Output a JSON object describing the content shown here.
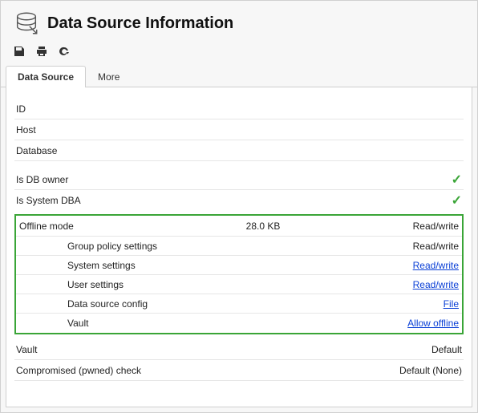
{
  "header": {
    "title": "Data Source Information"
  },
  "toolbar": {
    "save_icon": "save-icon",
    "print_icon": "print-icon",
    "refresh_icon": "refresh-icon"
  },
  "tabs": [
    {
      "label": "Data Source",
      "active": true
    },
    {
      "label": "More",
      "active": false
    }
  ],
  "fields": {
    "id": {
      "label": "ID",
      "value": ""
    },
    "host": {
      "label": "Host",
      "value": ""
    },
    "database": {
      "label": "Database",
      "value": ""
    },
    "is_db_owner": {
      "label": "Is DB owner",
      "checked": true
    },
    "is_system_dba": {
      "label": "Is System DBA",
      "checked": true
    }
  },
  "offline": {
    "label": "Offline mode",
    "size": "28.0 KB",
    "mode": "Read/write",
    "items": [
      {
        "label": "Group policy settings",
        "value": "Read/write",
        "link": false
      },
      {
        "label": "System settings",
        "value": "Read/write",
        "link": true
      },
      {
        "label": "User settings",
        "value": "Read/write",
        "link": true
      },
      {
        "label": "Data source config",
        "value": "File",
        "link": true
      },
      {
        "label": "Vault",
        "value": "Allow offline",
        "link": true
      }
    ]
  },
  "footer": {
    "vault": {
      "label": "Vault",
      "value": "Default"
    },
    "compromised": {
      "label": "Compromised (pwned) check",
      "value": "Default (None)"
    }
  }
}
